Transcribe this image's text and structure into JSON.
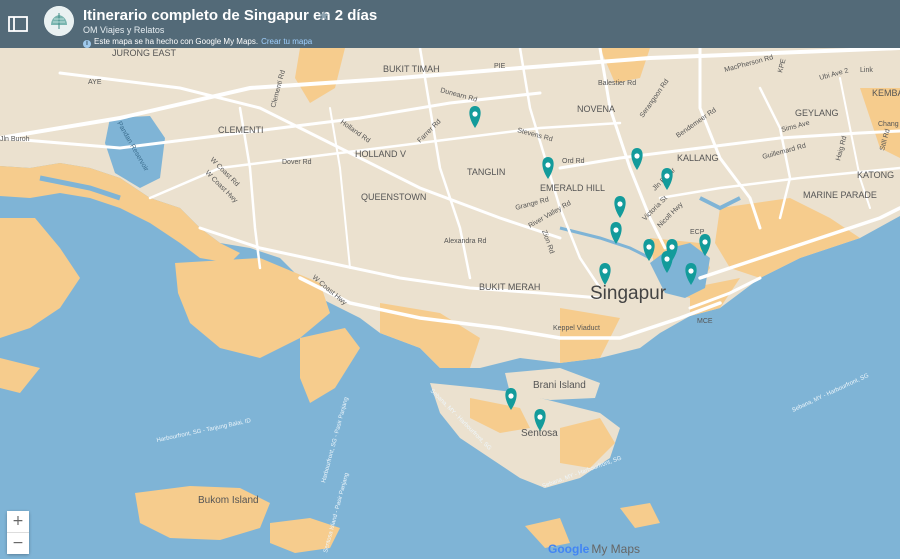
{
  "header": {
    "title": "Itinerario completo de Singapur en 2 días",
    "author": "OM Viajes y Relatos",
    "notice_text": "Este mapa se ha hecho con Google My Maps.",
    "notice_link": "Crear tu mapa",
    "star_icon": "star-icon",
    "panel_icon": "panel-toggle-icon"
  },
  "map": {
    "city_label": "Singapur",
    "districts": [
      "JURONG EAST",
      "BUKIT TIMAH",
      "NOVENA",
      "GEYLANG",
      "KALLANG",
      "CLEMENTI",
      "HOLLAND V",
      "TANGLIN",
      "EMERALD HILL",
      "QUEENSTOWN",
      "BUKIT MERAH",
      "MARINE PARADE",
      "KATONG",
      "KEMBA"
    ],
    "roads": [
      "AYE",
      "Jln Buroh",
      "Pandan Reservoir",
      "W Coast Rd",
      "W Coast Hwy",
      "Dover Rd",
      "Holland Rd",
      "Farrer Rd",
      "Dunearn Rd",
      "PIE",
      "Stevens Rd",
      "Grange Rd",
      "River Valley Rd",
      "Zion Rd",
      "Alexandra Rd",
      "W Coast Hwy",
      "Keppel Viaduct",
      "ECP",
      "MCE",
      "KPE",
      "Balestier Rd",
      "MacPherson Rd",
      "Ubi Ave 2",
      "Serangoon Rd",
      "Bendemeer Rd",
      "Sims Ave",
      "Guillemard Rd",
      "Haig Rd",
      "Nicoll Hwy",
      "Victoria St",
      "Jln Besar",
      "Clementi Rd",
      "Ord Rd",
      "Link",
      "Chang",
      "Still Rd"
    ],
    "islands": [
      "Brani Island",
      "Sentosa",
      "Bukom Island"
    ],
    "ferry_routes": [
      "Harbourfront, SG - Tanjung Balai, ID",
      "Harbourfront, SG - Pasir Panjang",
      "Sentosa Island - Pasir Panjang",
      "Sebana, MY - Harbourfront, SG",
      "Sebana, MY - Harbourfront, SG",
      "Sebana, MY - Harbourfront, SG"
    ],
    "marker_color": "#139b9b",
    "marker_count": 14
  },
  "controls": {
    "zoom_in": "+",
    "zoom_out": "−"
  },
  "branding": {
    "google": "Google",
    "mymaps": "My Maps"
  },
  "colors": {
    "water": "#7fb4d6",
    "land": "#ebe1cf",
    "reclaimed": "#f6cc8d",
    "header": "#536a78",
    "marker": "#139b9b"
  }
}
